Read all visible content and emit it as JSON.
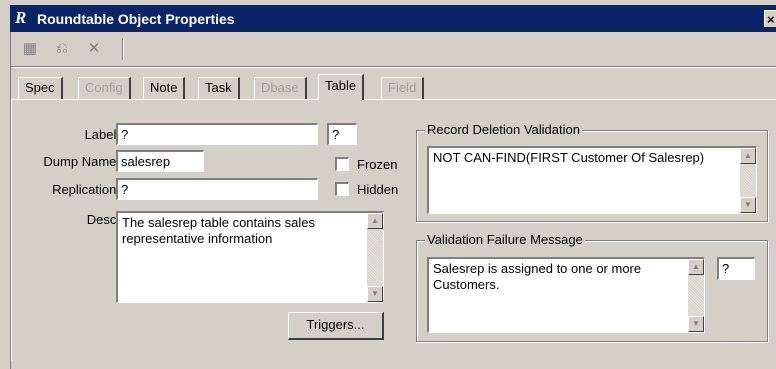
{
  "window": {
    "title": "Roundtable Object Properties",
    "app_glyph": "R",
    "close_glyph": "×"
  },
  "toolbar": {
    "buttons": [
      {
        "icon": "save-icon",
        "glyph": "▦"
      },
      {
        "icon": "undo-icon",
        "glyph": "⎌"
      },
      {
        "icon": "delete-icon",
        "glyph": "✕"
      }
    ]
  },
  "tabs": [
    {
      "label": "Spec",
      "enabled": true
    },
    {
      "label": "Config",
      "enabled": false
    },
    {
      "label": "Note",
      "enabled": true
    },
    {
      "label": "Task",
      "enabled": true
    },
    {
      "label": "Dbase",
      "enabled": false
    },
    {
      "label": "Table",
      "enabled": true,
      "active": true
    },
    {
      "label": "Field",
      "enabled": false
    }
  ],
  "form": {
    "label_label": "Label:",
    "label_value": "?",
    "label_extra": "?",
    "dump_name_label": "Dump Name:",
    "dump_name_value": "salesrep",
    "replication_label": "Replication:",
    "replication_value": "?",
    "desc_label": "Desc:",
    "desc_value": "The salesrep table contains sales representative information",
    "frozen_label": "Frozen",
    "frozen_checked": false,
    "hidden_label": "Hidden",
    "hidden_checked": false,
    "triggers_button": "Triggers..."
  },
  "record_deletion": {
    "title": "Record Deletion Validation",
    "value": "NOT CAN-FIND(FIRST Customer Of Salesrep)"
  },
  "validation_failure": {
    "title": "Validation Failure Message",
    "value": "Salesrep is assigned to one or more Customers.",
    "extra": "?"
  }
}
